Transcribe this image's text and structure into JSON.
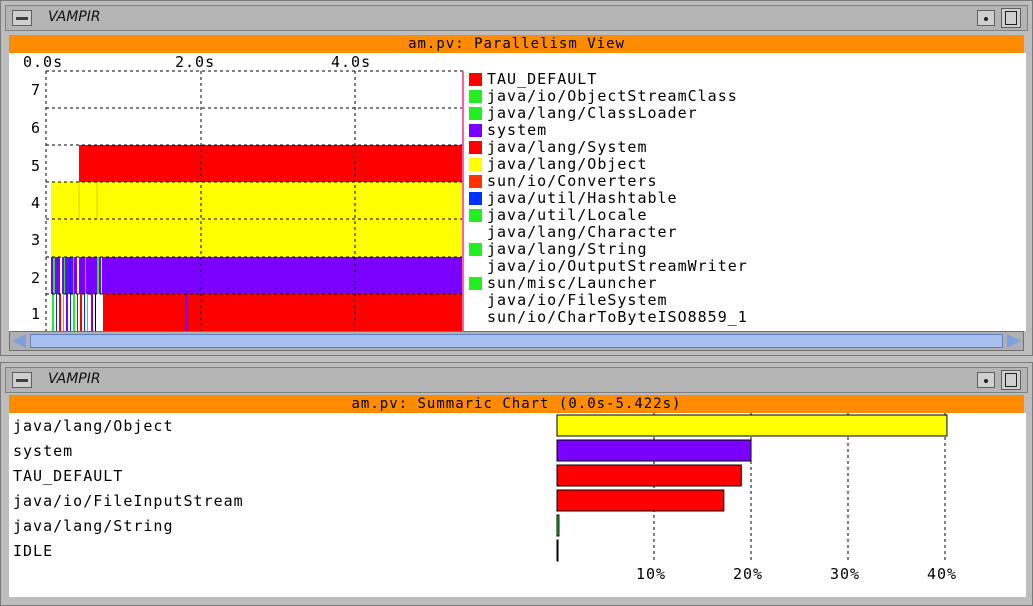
{
  "window_top": {
    "title": "VAMPIR",
    "header": "am.pv: Parallelism View",
    "axis_ticks": [
      "0.0s",
      "2.0s",
      "4.0s"
    ],
    "y_ticks": [
      "7",
      "6",
      "5",
      "4",
      "3",
      "2",
      "1"
    ]
  },
  "legend": [
    {
      "label": "TAU_DEFAULT",
      "color": "#ff0000"
    },
    {
      "label": "java/io/ObjectStreamClass",
      "color": "#22ee22"
    },
    {
      "label": "java/lang/ClassLoader",
      "color": "#22ee22"
    },
    {
      "label": "system",
      "color": "#7a00ff"
    },
    {
      "label": "java/lang/System",
      "color": "#ff0000"
    },
    {
      "label": "java/lang/Object",
      "color": "#ffff00"
    },
    {
      "label": "sun/io/Converters",
      "color": "#ff3300"
    },
    {
      "label": "java/util/Hashtable",
      "color": "#0030ff"
    },
    {
      "label": "java/util/Locale",
      "color": "#22ee22"
    },
    {
      "label": "java/lang/Character",
      "color": "#ffffff"
    },
    {
      "label": "java/lang/String",
      "color": "#22ee22"
    },
    {
      "label": "java/io/OutputStreamWriter",
      "color": "#ffffff"
    },
    {
      "label": "sun/misc/Launcher",
      "color": "#22ee22"
    },
    {
      "label": "java/io/FileSystem",
      "color": "#ffffff"
    },
    {
      "label": "sun/io/CharToByteISO8859_1",
      "color": "#ffffff"
    }
  ],
  "window_bottom": {
    "title": "VAMPIR",
    "header": "am.pv: Summaric Chart (0.0s-5.422s)"
  },
  "chart_data": {
    "type": "bar",
    "orientation": "horizontal",
    "categories": [
      "java/lang/Object",
      "system",
      "TAU_DEFAULT",
      "java/io/FileInputStream",
      "java/lang/String",
      "IDLE"
    ],
    "values": [
      40.2,
      20.0,
      19.0,
      17.2,
      0.2,
      0.1
    ],
    "colors": [
      "#ffff00",
      "#7a00ff",
      "#ff0000",
      "#ff0000",
      "#22ee22",
      "#000000"
    ],
    "xticks": [
      "10%",
      "20%",
      "30%",
      "40%"
    ],
    "xlim": [
      0,
      47
    ],
    "grid": true
  }
}
